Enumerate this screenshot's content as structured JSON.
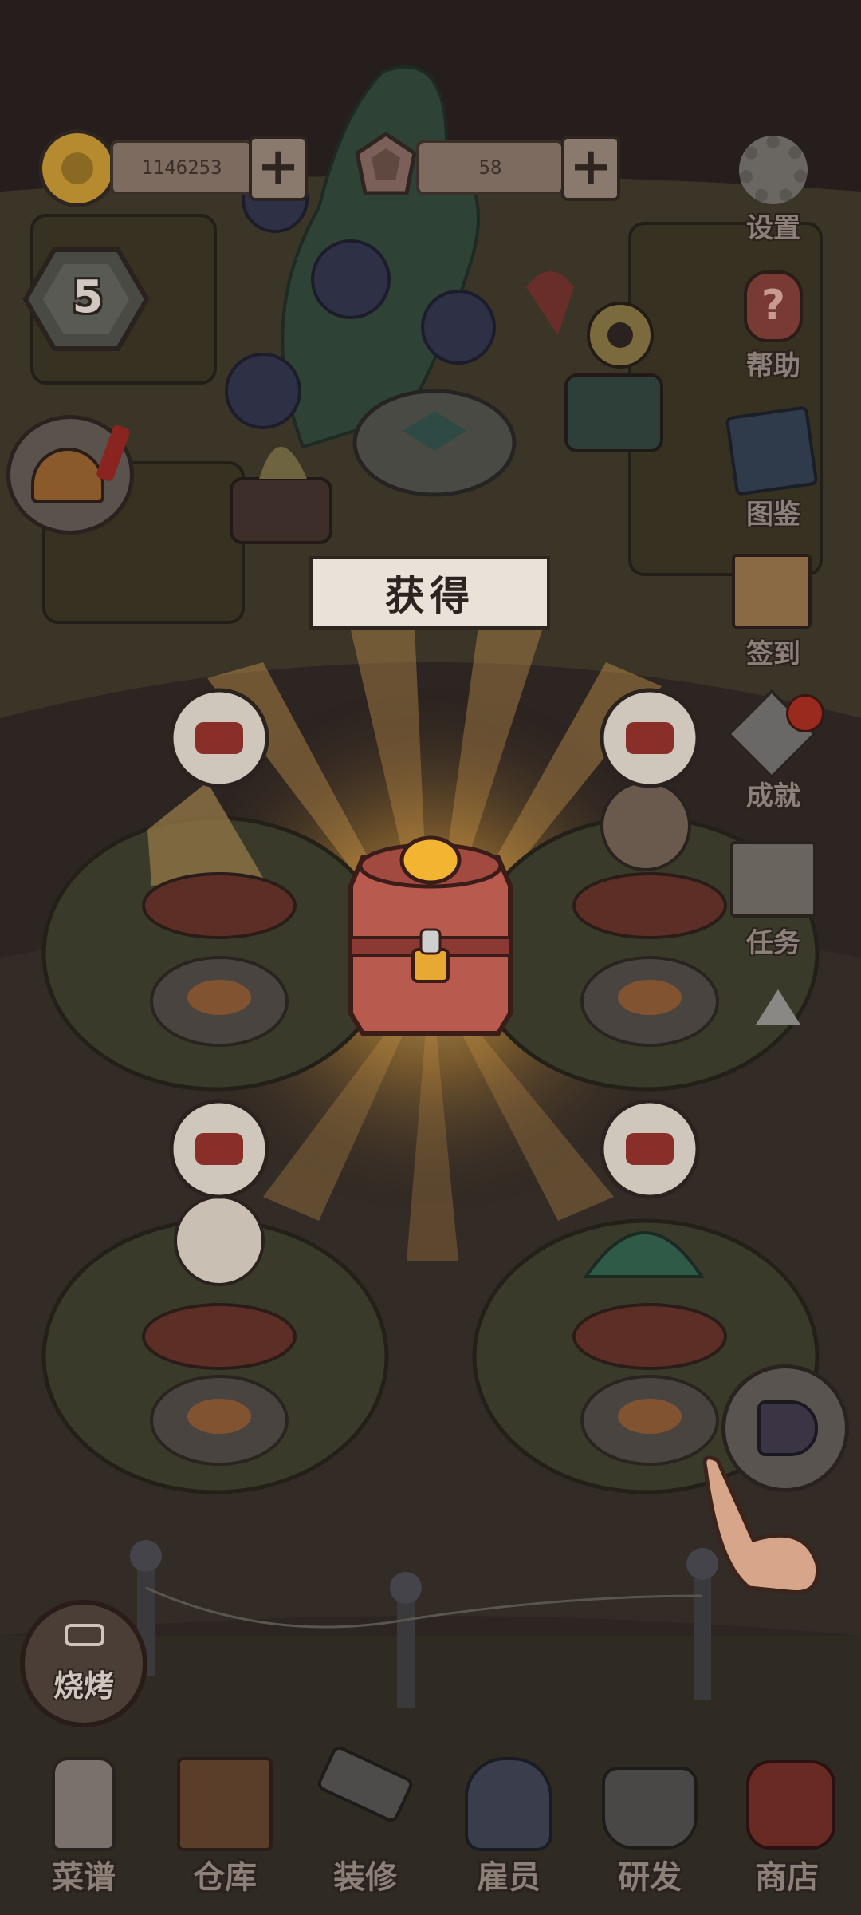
{
  "currency": {
    "coins": "1146253",
    "gems": "58",
    "coin_add_label": "+",
    "gem_add_label": "+"
  },
  "level": "5",
  "banner_title": "获得",
  "side_menu": {
    "settings": "设置",
    "help": "帮助",
    "collection": "图鉴",
    "checkin": "签到",
    "achievements": "成就",
    "tasks": "任务"
  },
  "grill_button_label": "烧烤",
  "bottom_nav": [
    {
      "key": "recipes",
      "label": "菜谱"
    },
    {
      "key": "warehouse",
      "label": "仓库"
    },
    {
      "key": "decorate",
      "label": "装修"
    },
    {
      "key": "staff",
      "label": "雇员"
    },
    {
      "key": "research",
      "label": "研发"
    },
    {
      "key": "shop",
      "label": "商店"
    }
  ],
  "colors": {
    "dim_overlay": "#2b2420",
    "glow": "#f0b040",
    "chest": "#b85a4e",
    "banner_bg": "#e8e2d8",
    "notification_red": "#c0392b"
  }
}
